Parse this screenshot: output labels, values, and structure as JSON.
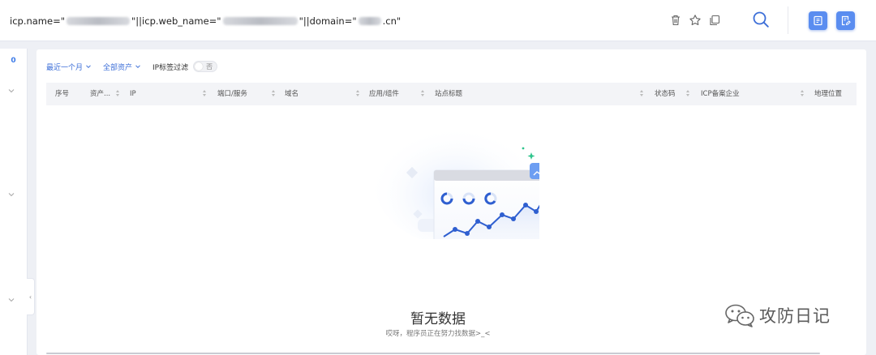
{
  "search": {
    "query_part1": "icp.name=\"",
    "query_part2": "\"||icp.web_name=\"",
    "query_part3": "\"||domain=\"",
    "query_part4": ".cn\""
  },
  "toolbar": {
    "icons": [
      "trash-icon",
      "star-icon",
      "copy-icon",
      "search-icon",
      "report-icon",
      "edit-report-icon"
    ],
    "accent": "#5a8df0"
  },
  "rail": {
    "count": "0"
  },
  "filters": {
    "time_range": "最近一个月",
    "assets": "全部资产",
    "ip_tag_filter": "IP标签过滤",
    "toggle_state": "否"
  },
  "table": {
    "columns": [
      "序号",
      "资产...",
      "IP",
      "端口/服务",
      "域名",
      "应用/组件",
      "站点标题",
      "状态码",
      "ICP备案企业",
      "地理位置"
    ]
  },
  "empty": {
    "title": "暂无数据",
    "subtitle": "哎呀，程序员正在努力找数据>_<"
  },
  "watermark": {
    "text": "攻防日记"
  },
  "colors": {
    "link": "#3d6fd8",
    "accent_green": "#2ec48c",
    "chart_blue": "#2f5fd0"
  }
}
